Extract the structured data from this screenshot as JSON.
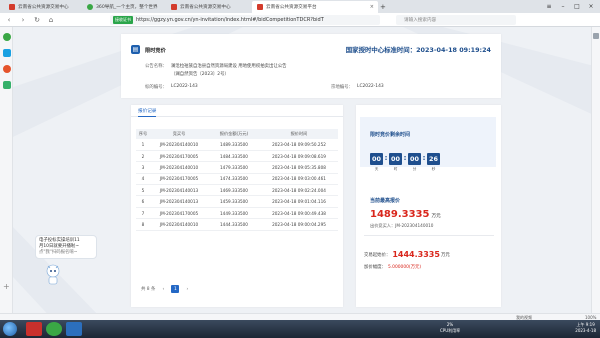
{
  "browser": {
    "tabs": [
      {
        "label": "云南省公共资源交易中心",
        "color": "#d33b2c"
      },
      {
        "label": "360导航_一个主页，整个世界",
        "color": "#3aa745"
      },
      {
        "label": "云南省公共资源交易中心",
        "color": "#d33b2c"
      },
      {
        "label": "云南省公共资源交易平台",
        "color": "#d33b2c"
      }
    ],
    "secure_label": "接收证书",
    "url": "https://ggzy.yn.gov.cn/yn-invitation/index.html#/bidCompetitionTDCR?bidT",
    "search_placeholder": "请输入搜索内容"
  },
  "header": {
    "title": "限时竞价",
    "time_label": "国家授时中心标准时间：",
    "time_value": "2023-04-18 09:19:24",
    "announcement_label": "公告名称：",
    "announcement_line1": "澜沧拉祜族自治县自然资源局建设 用地使用权拍卖出让公告",
    "announcement_line2": "（澜自然资告〔2023〕2号）",
    "lot_label": "标的编号：",
    "lot_value": "LC2022-143",
    "parcel_label": "宗地编号：",
    "parcel_value": "LC2022-143"
  },
  "records": {
    "tab_label": "报价记录",
    "columns": [
      "序号",
      "竞买号",
      "报价金额(万元)",
      "报价时间"
    ],
    "rows": [
      [
        "1",
        "JM-202304140010",
        "1489.333500",
        "2023-04-18 09:09:50.252"
      ],
      [
        "2",
        "JM-202304170005",
        "1484.333500",
        "2023-04-18 09:09:08.619"
      ],
      [
        "3",
        "JM-202304140010",
        "1479.333500",
        "2023-04-18 09:05:35.808"
      ],
      [
        "4",
        "JM-202304170005",
        "1474.333500",
        "2023-04-18 09:03:00.461"
      ],
      [
        "5",
        "JM-202304140013",
        "1469.333500",
        "2023-04-18 09:02:24.004"
      ],
      [
        "6",
        "JM-202304140013",
        "1459.333500",
        "2023-04-18 09:01:04.116"
      ],
      [
        "7",
        "JM-202304170005",
        "1449.333500",
        "2023-04-18 09:00:49.438"
      ],
      [
        "8",
        "JM-202304140010",
        "1444.333500",
        "2023-04-18 09:00:04.295"
      ]
    ],
    "total_label": "共 8 条",
    "prev": "‹",
    "page": "1",
    "next": "›"
  },
  "countdown": {
    "title": "限时竞价剩余时间",
    "days": "00",
    "days_unit": "天",
    "hours": "00",
    "hours_unit": "时",
    "minutes": "00",
    "minutes_unit": "分",
    "seconds": "26",
    "seconds_unit": "秒"
  },
  "highest": {
    "title": "当前最高报价",
    "value": "1489.3335",
    "unit": "万元",
    "bidder_label": "出价竞买人：",
    "bidder_value": "JM-202304140010"
  },
  "offer": {
    "start_label": "交易起始价：",
    "start_value": "1444.3335",
    "start_unit": "万元",
    "step_label": "加价幅度：",
    "step_value": "5.000000(万元)"
  },
  "bot": {
    "line1": "电子投标实操培训11",
    "line2": "月10日就要开播啦~",
    "hint": "点\"我\"扫码报名唷~"
  },
  "statusbar": {
    "left": "",
    "right1": "我的视频",
    "zoom": "100%"
  },
  "taskbar": {
    "cpu_pct": "2%",
    "cpu_label": "CPU利用率",
    "time": "上午 9:19",
    "date": "2023-4-18"
  }
}
